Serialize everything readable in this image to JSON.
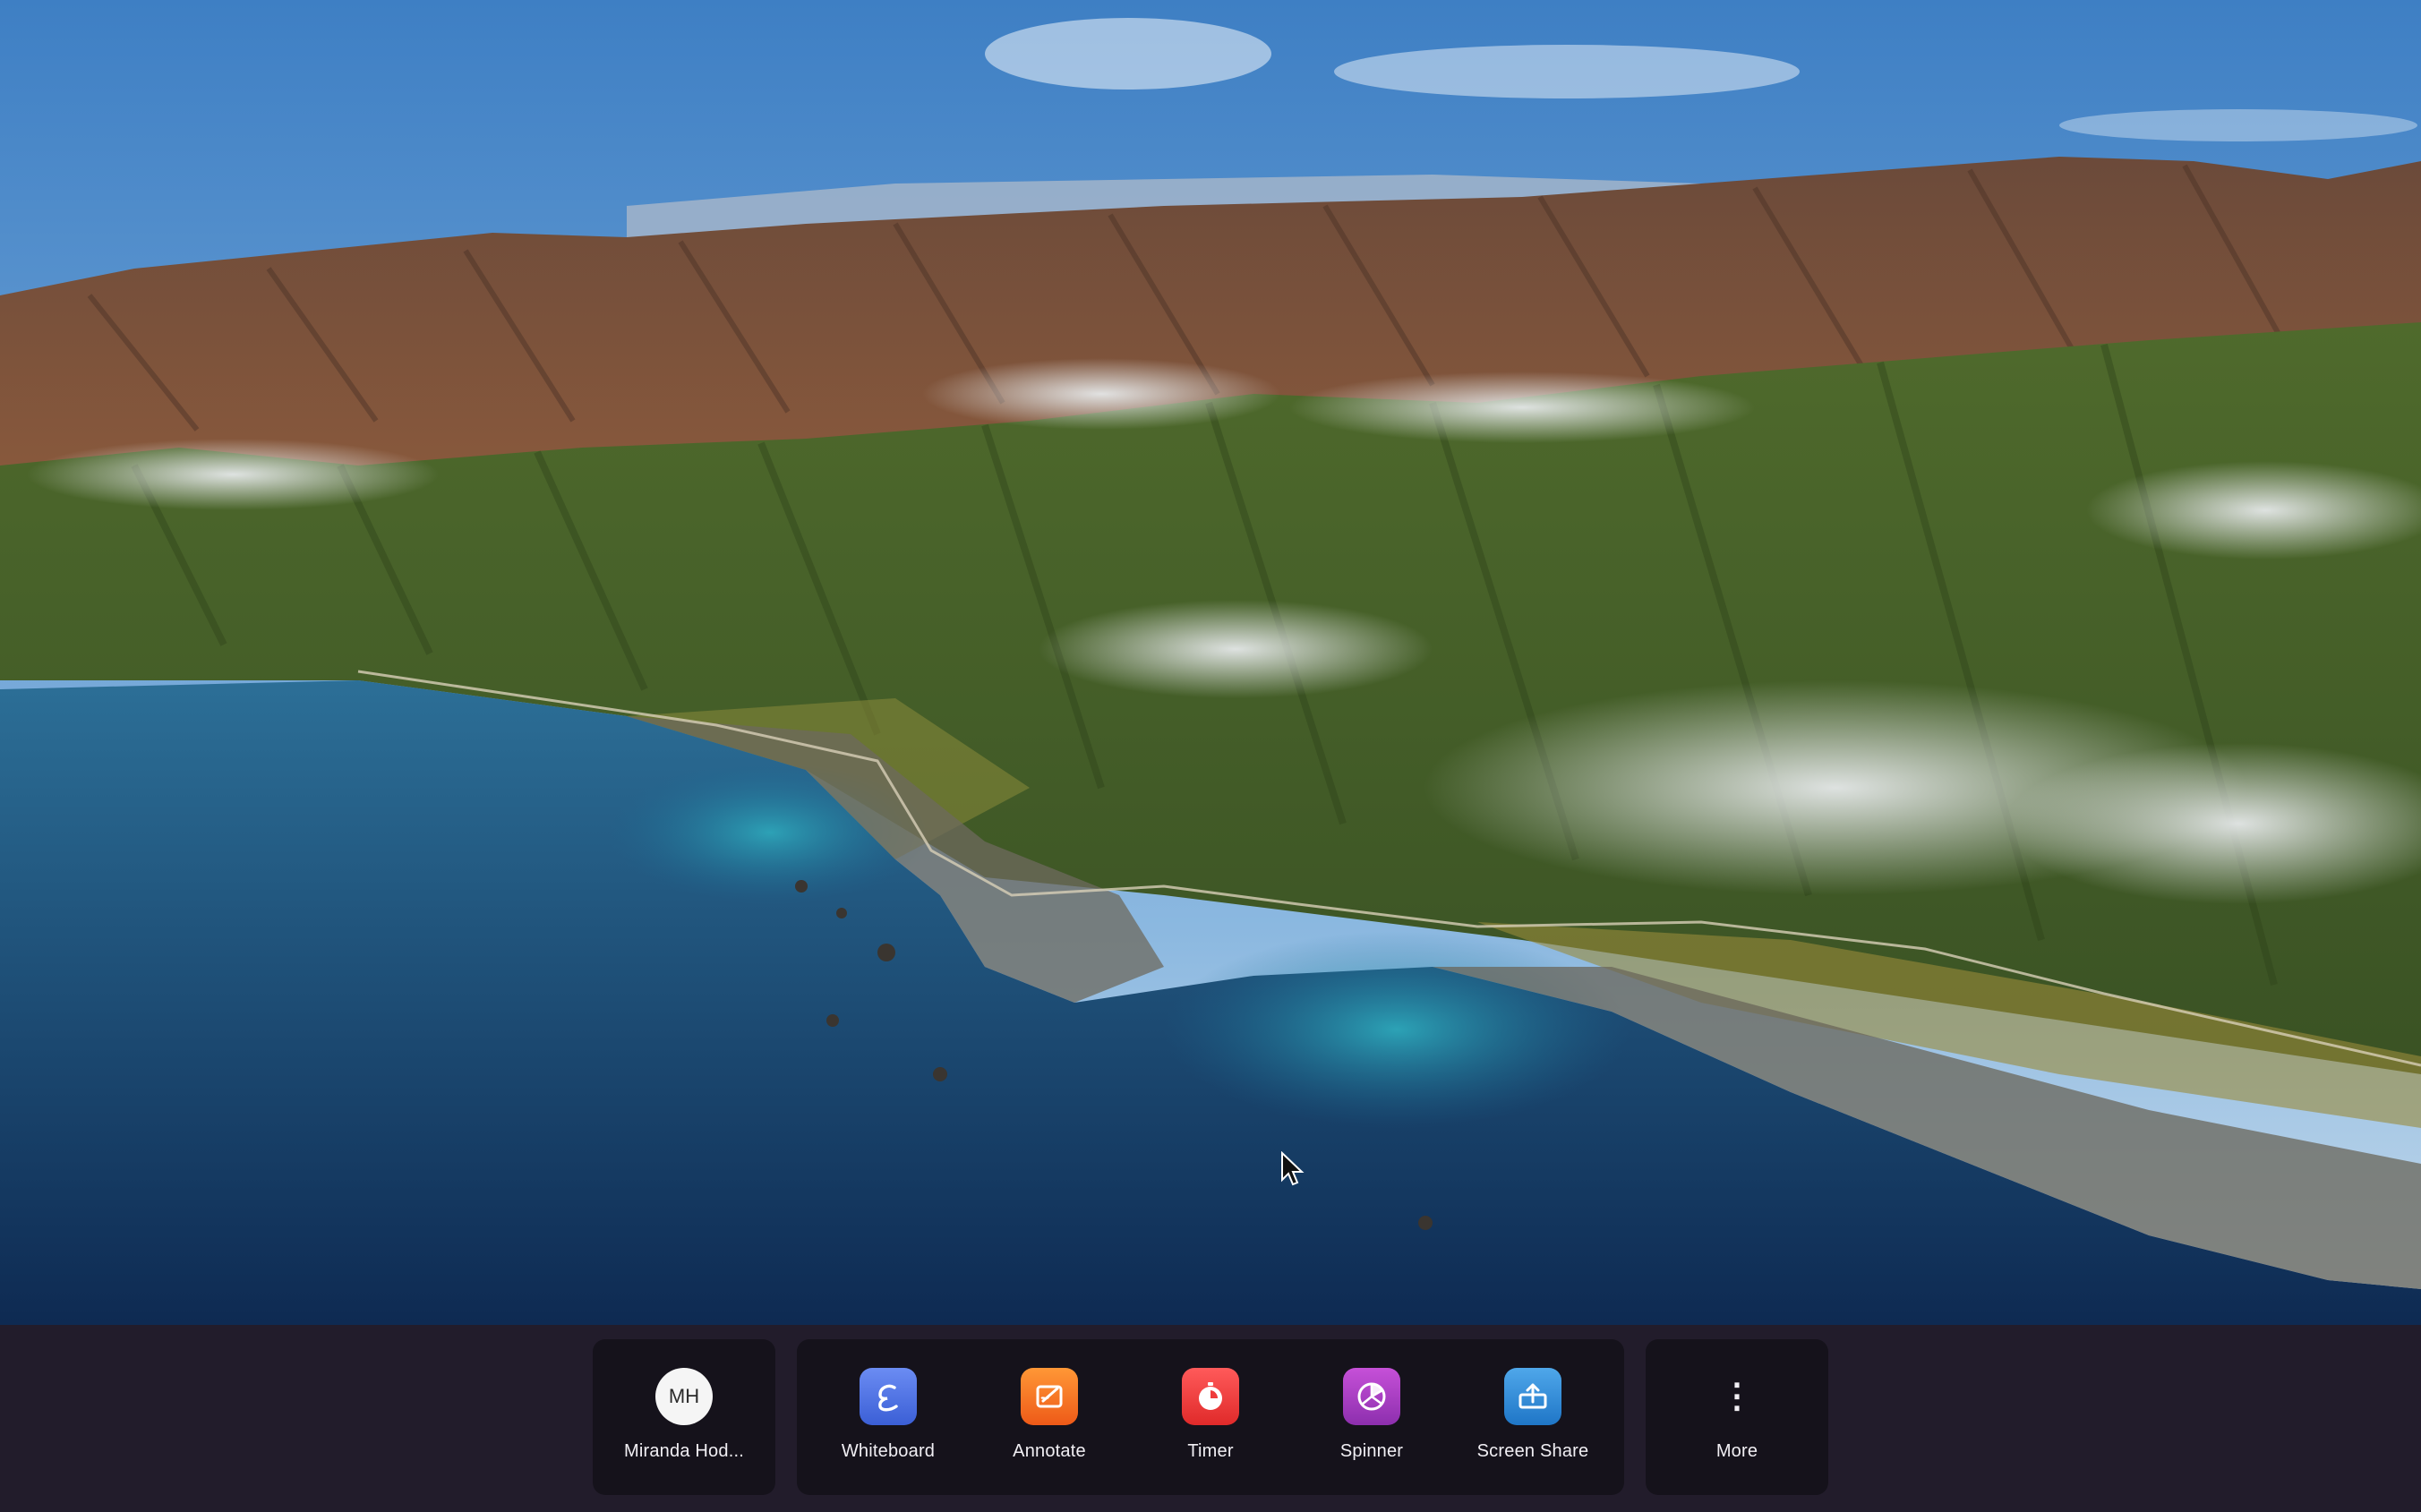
{
  "desktop": {
    "wallpaper_icon": "landscape-wallpaper"
  },
  "taskbar": {
    "user": {
      "initials": "MH",
      "label": "Miranda Hod..."
    },
    "tools": [
      {
        "label": "Whiteboard",
        "icon": "whiteboard-icon"
      },
      {
        "label": "Annotate",
        "icon": "annotate-icon"
      },
      {
        "label": "Timer",
        "icon": "timer-icon"
      },
      {
        "label": "Spinner",
        "icon": "spinner-icon"
      },
      {
        "label": "Screen Share",
        "icon": "screen-share-icon"
      }
    ],
    "more": {
      "glyph": "⋮",
      "label": "More"
    }
  },
  "colors": {
    "taskbar_bg": "#221c2b",
    "group_bg": "#15121b",
    "whiteboard": "#4a6fe0",
    "annotate": "#f5761f",
    "timer": "#ef3b3b",
    "spinner": "#b040c8",
    "screen_share": "#2f8ad8"
  }
}
